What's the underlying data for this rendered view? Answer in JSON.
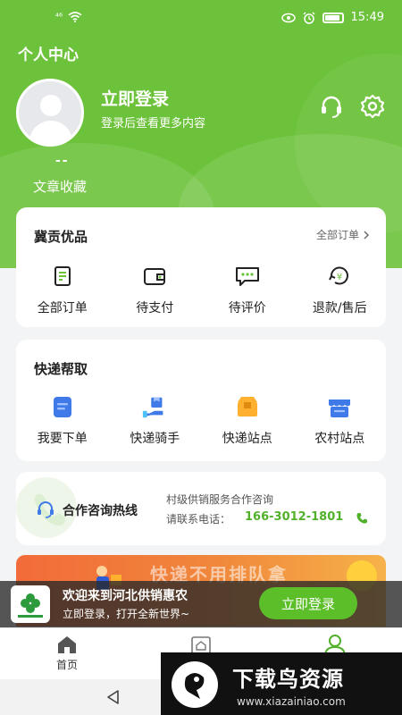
{
  "status_bar": {
    "signal": "⁴⁶",
    "time": "15:49"
  },
  "header": {
    "title": "个人中心",
    "login_title": "立即登录",
    "login_subtitle": "登录后查看更多内容",
    "collect_count": "--",
    "collect_label": "文章收藏"
  },
  "orders_card": {
    "title": "冀贡优品",
    "all_orders_label": "全部订单",
    "items": [
      {
        "label": "全部订单",
        "icon": "scroll-icon"
      },
      {
        "label": "待支付",
        "icon": "wallet-icon"
      },
      {
        "label": "待评价",
        "icon": "chat-bubble-icon"
      },
      {
        "label": "退款/售后",
        "icon": "yen-refund-icon"
      }
    ]
  },
  "express_card": {
    "title": "快递帮取",
    "items": [
      {
        "label": "我要下单",
        "icon": "clipboard-icon"
      },
      {
        "label": "快递骑手",
        "icon": "hand-package-icon"
      },
      {
        "label": "快递站点",
        "icon": "parcel-box-icon"
      },
      {
        "label": "农村站点",
        "icon": "store-icon"
      }
    ]
  },
  "hotline_card": {
    "label": "合作咨询热线",
    "description": "村级供销服务合作咨询",
    "phone_prefix": "请联系电话：",
    "phone": "166-3012-1801"
  },
  "banner": {
    "text": "快递不用排队拿"
  },
  "promo": {
    "title": "欢迎来到河北供销惠农",
    "subtitle": "立即登录，打开全新世界~",
    "button_label": "立即登录"
  },
  "tabbar": {
    "items": [
      {
        "label": "首页",
        "icon": "home-icon"
      },
      {
        "label": "",
        "icon": "shop-icon"
      },
      {
        "label": "",
        "icon": "user-icon"
      }
    ]
  },
  "watermark": {
    "main": "下载鸟资源",
    "url": "www.xiazainiao.com"
  },
  "colors": {
    "primary_green": "#6cc23a",
    "phone_green": "#52b12a",
    "button_green": "#5cbf2a"
  }
}
